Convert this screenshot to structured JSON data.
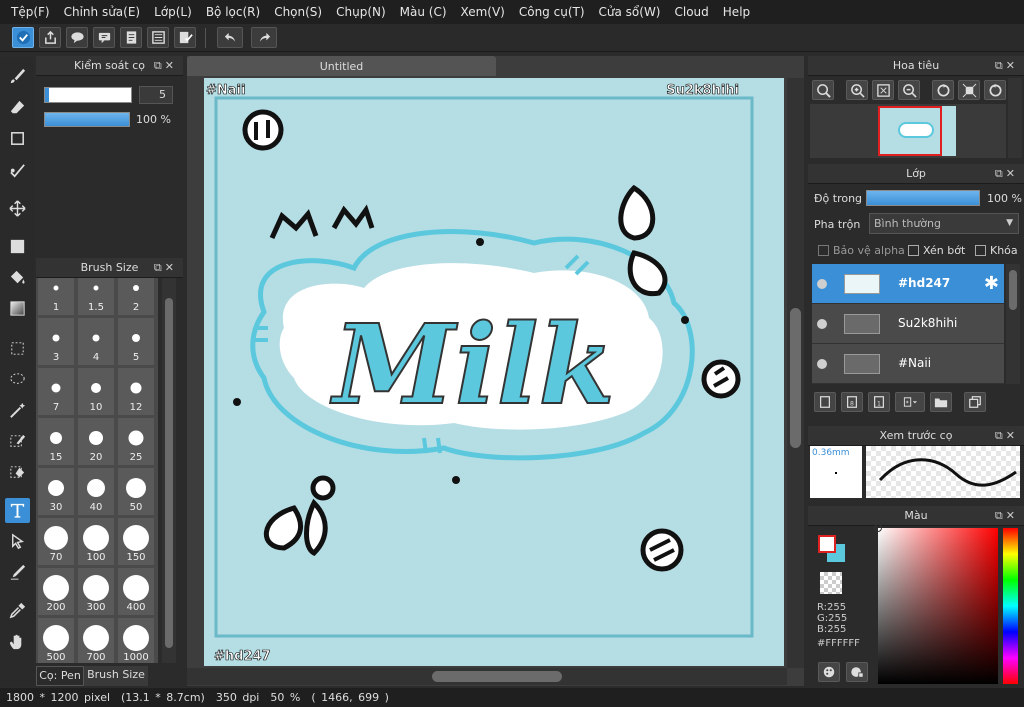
{
  "menu": [
    "Tệp(F)",
    "Chỉnh sửa(E)",
    "Lớp(L)",
    "Bộ lọc(R)",
    "Chọn(S)",
    "Chụp(N)",
    "Màu (C)",
    "Xem(V)",
    "Công cụ(T)",
    "Cửa sổ(W)",
    "Cloud",
    "Help"
  ],
  "brush_control": {
    "title": "Kiểm soát cọ",
    "size_value": "5",
    "opacity_value": "100 %"
  },
  "brush_size": {
    "title": "Brush Size",
    "sizes": [
      "1",
      "1.5",
      "2",
      "3",
      "4",
      "5",
      "7",
      "10",
      "12",
      "15",
      "20",
      "25",
      "30",
      "40",
      "50",
      "70",
      "100",
      "150",
      "200",
      "300",
      "400",
      "500",
      "700",
      "1000"
    ],
    "tabs": {
      "pen": "Cọ: Pen",
      "size": "Brush Size"
    }
  },
  "document": {
    "tab_title": "Untitled"
  },
  "artwork": {
    "word": "Milk",
    "tag_top_left": "#Naii",
    "tag_top_right": "Su2k8hihi",
    "tag_bottom_left": "#hd247",
    "background_color": "#b4dde4",
    "accent_color": "#5bc8dd"
  },
  "navigator": {
    "title": "Hoa tiêu"
  },
  "layers_panel": {
    "title": "Lớp",
    "opacity_label": "Độ trong",
    "opacity_value": "100 %",
    "blend_label": "Pha trộn",
    "blend_value": "Bình thường",
    "protect_alpha": "Bảo vệ alpha",
    "clipping": "Xén bớt",
    "lock": "Khóa",
    "layers": [
      {
        "name": "#hd247",
        "selected": true
      },
      {
        "name": "Su2k8hihi",
        "selected": false
      },
      {
        "name": "#Naii",
        "selected": false
      }
    ]
  },
  "brush_preview": {
    "title": "Xem trước cọ",
    "size": "0.36mm"
  },
  "color_panel": {
    "title": "Màu",
    "r": "R:255",
    "g": "G:255",
    "b": "B:255",
    "hex": "#FFFFFF"
  },
  "status": {
    "pixels": "1800 * 1200 pixel",
    "physical": "(13.1 * 8.7cm)",
    "dpi": "350 dpi",
    "zoom": "50 %",
    "coords": "( 1466, 699 )"
  }
}
